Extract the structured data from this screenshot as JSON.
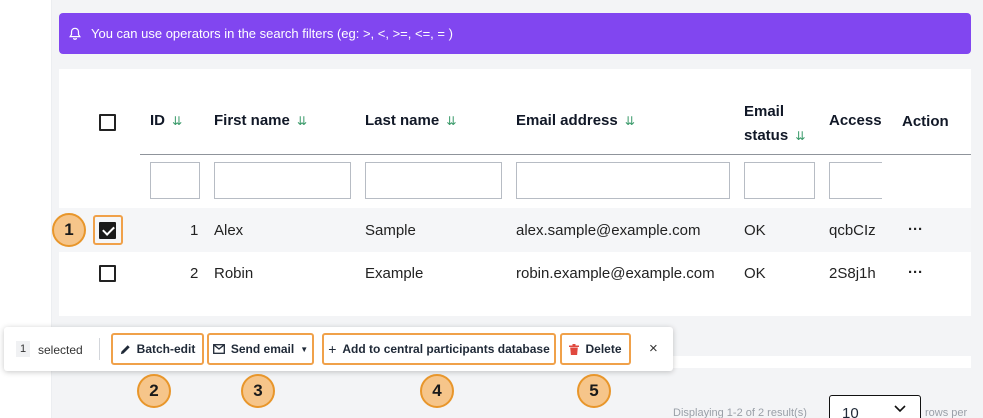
{
  "banner": {
    "text": "You can use operators in the search filters (eg: >, <, >=, <=, = )"
  },
  "table": {
    "headers": {
      "id": "ID",
      "first_name": "First name",
      "last_name": "Last name",
      "email": "Email address",
      "email_status_1": "Email",
      "email_status_2": "status",
      "access": "Access",
      "action": "Action"
    },
    "sort_icon": "⇊",
    "rows": [
      {
        "id": "1",
        "first_name": "Alex",
        "last_name": "Sample",
        "email": "alex.sample@example.com",
        "status": "OK",
        "access": "qcbCIz",
        "action": "···"
      },
      {
        "id": "2",
        "first_name": "Robin",
        "last_name": "Example",
        "email": "robin.example@example.com",
        "status": "OK",
        "access": "2S8j1h",
        "action": "···"
      }
    ]
  },
  "toolbar": {
    "count": "1",
    "selected_label": "selected",
    "batch_edit": "Batch-edit",
    "send_email": "Send email",
    "add_central": "Add to central participants database",
    "delete": "Delete",
    "close": "×"
  },
  "badges": [
    "1",
    "2",
    "3",
    "4",
    "5"
  ],
  "footer": {
    "displaying": "Displaying 1-2 of 2 result(s)",
    "rows_value": "10",
    "rows_per": "rows per"
  },
  "colors": {
    "banner": "#8146f0",
    "highlight": "#f0a14a",
    "badge_fill": "#f6c58a",
    "sort": "#3a9a6a",
    "delete_icon": "#e0483e"
  },
  "icons": [
    "bell-icon",
    "sort-icon",
    "pencil-icon",
    "mail-icon",
    "caret-down-icon",
    "plus-icon",
    "trash-icon",
    "close-icon",
    "chevron-down-icon",
    "more-icon"
  ]
}
